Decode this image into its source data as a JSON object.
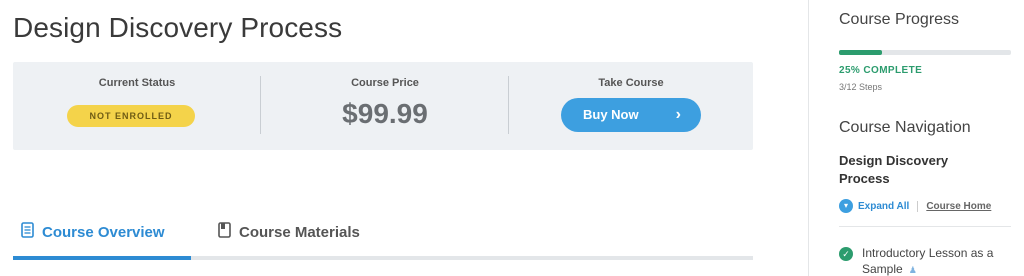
{
  "page": {
    "title": "Design Discovery Process"
  },
  "status": {
    "current_status_label": "Current Status",
    "current_status_value": "NOT ENROLLED",
    "price_label": "Course Price",
    "price_value": "$99.99",
    "take_course_label": "Take Course",
    "buy_button_label": "Buy Now",
    "buy_button_icon": "chevron-right-icon"
  },
  "tabs": [
    {
      "label": "Course Overview",
      "icon": "document-icon",
      "active": true
    },
    {
      "label": "Course Materials",
      "icon": "notebook-icon",
      "active": false
    }
  ],
  "sidebar": {
    "progress_heading": "Course Progress",
    "progress_fraction": 0.25,
    "progress_text": "25% COMPLETE",
    "steps_text": "3/12 Steps",
    "nav_heading": "Course Navigation",
    "course_title": "Design Discovery Process",
    "expand_all_label": "Expand All",
    "course_home_label": "Course Home",
    "lessons": [
      {
        "title": "Introductory Lesson as a Sample",
        "completed": true,
        "sample": true
      }
    ]
  },
  "colors": {
    "accent_blue": "#3d9fe0",
    "progress_green": "#2c9c6e",
    "badge_yellow": "#f4d34a",
    "card_bg": "#eef1f4"
  }
}
